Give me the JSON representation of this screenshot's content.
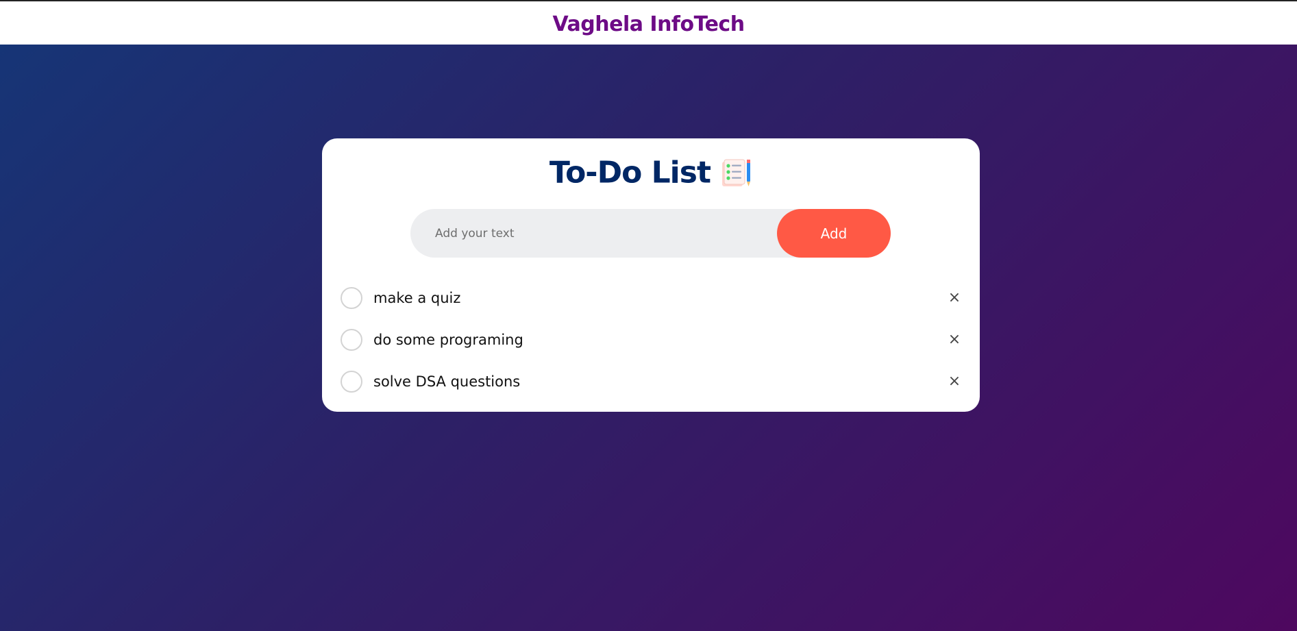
{
  "header": {
    "brand": "Vaghela InfoTech"
  },
  "todo": {
    "title": "To-Do List",
    "title_icon": "clipboard-list-icon",
    "input": {
      "placeholder": "Add your text",
      "value": ""
    },
    "add_label": "Add",
    "tasks": [
      {
        "text": "make a quiz",
        "done": false,
        "remove_icon": "×"
      },
      {
        "text": "do some programing",
        "done": false,
        "remove_icon": "×"
      },
      {
        "text": "solve DSA questions",
        "done": false,
        "remove_icon": "×"
      }
    ]
  },
  "colors": {
    "brand": "#6d0b86",
    "title": "#002765",
    "accent": "#ff5945",
    "input_bg": "#edeef0",
    "bg_gradient_start": "#153677",
    "bg_gradient_end": "#4e085f"
  }
}
